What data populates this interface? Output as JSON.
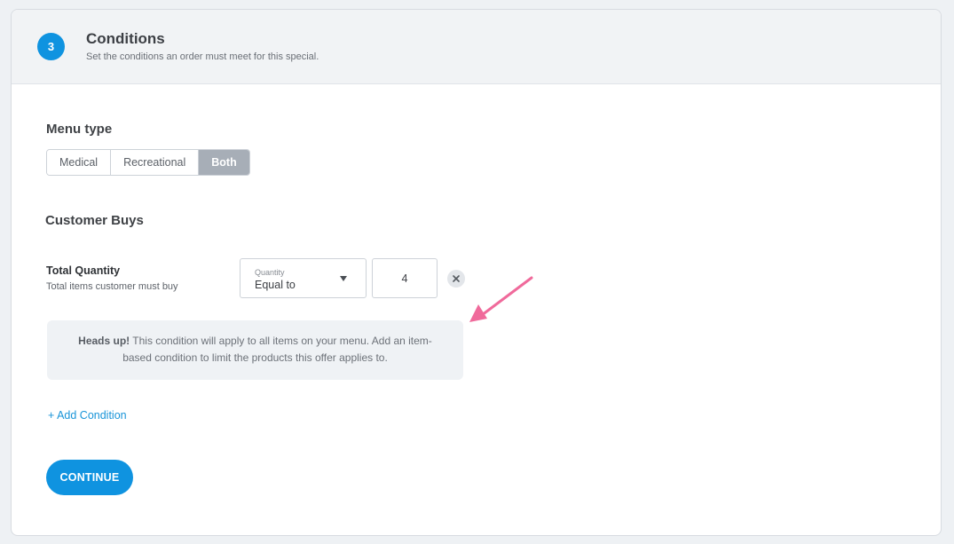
{
  "header": {
    "step_number": "3",
    "title": "Conditions",
    "subtitle": "Set the conditions an order must meet for this special."
  },
  "menu_type": {
    "label": "Menu type",
    "options": [
      "Medical",
      "Recreational",
      "Both"
    ],
    "selected": "Both"
  },
  "customer_buys": {
    "label": "Customer Buys",
    "condition": {
      "label": "Total Quantity",
      "help": "Total items customer must buy",
      "select_caption": "Quantity",
      "select_value": "Equal to",
      "quantity_value": "4"
    }
  },
  "notice": {
    "strong": "Heads up!",
    "text": " This condition will apply to all items on your menu. Add an item-based condition to limit the products this offer applies to."
  },
  "add_condition_label": "+ Add Condition",
  "continue_label": "CONTINUE",
  "colors": {
    "accent": "#0f93e0",
    "link": "#1894d8",
    "annotation_arrow": "#f06a9b"
  }
}
